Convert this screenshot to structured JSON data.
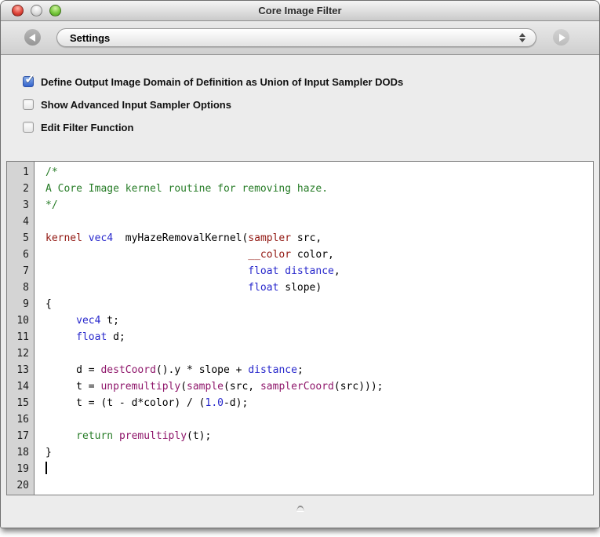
{
  "window": {
    "title": "Core Image Filter"
  },
  "titlebar_lights": {
    "close_color": "#d8453c",
    "minimize_color": "#d6d6d6",
    "zoom_color": "#6fbf3f"
  },
  "toolbar": {
    "popup_value": "Settings"
  },
  "options": [
    {
      "label": "Define Output Image Domain of Definition as Union of Input Sampler DODs",
      "checked": true
    },
    {
      "label": "Show Advanced Input Sampler Options",
      "checked": false
    },
    {
      "label": "Edit Filter Function",
      "checked": false
    }
  ],
  "colors": {
    "checkbox_checked_top": "#8ab2ef",
    "checkbox_checked_bottom": "#3463cc"
  },
  "editor": {
    "line_count": 20,
    "cursor_line": 19,
    "syntax_colors": {
      "comment": "#277c27",
      "keyword": "#921812",
      "type": "#2828cc",
      "builtin": "#8f176b",
      "plain": "#000000"
    },
    "lines": [
      [
        [
          "c",
          "/*"
        ]
      ],
      [
        [
          "c",
          "A Core Image kernel routine for removing haze."
        ]
      ],
      [
        [
          "c",
          "*/"
        ]
      ],
      [],
      [
        [
          "k",
          "kernel"
        ],
        [
          "p",
          " "
        ],
        [
          "t",
          "vec4"
        ],
        [
          "p",
          "  myHazeRemovalKernel("
        ],
        [
          "k",
          "sampler"
        ],
        [
          "p",
          " src,"
        ]
      ],
      [
        [
          "p",
          "                                 "
        ],
        [
          "k",
          "__color"
        ],
        [
          "p",
          " color,"
        ]
      ],
      [
        [
          "p",
          "                                 "
        ],
        [
          "t",
          "float"
        ],
        [
          "p",
          " "
        ],
        [
          "t",
          "distance"
        ],
        [
          "p",
          ","
        ]
      ],
      [
        [
          "p",
          "                                 "
        ],
        [
          "t",
          "float"
        ],
        [
          "p",
          " slope)"
        ]
      ],
      [
        [
          "p",
          "{"
        ]
      ],
      [
        [
          "p",
          "     "
        ],
        [
          "t",
          "vec4"
        ],
        [
          "p",
          " t;"
        ]
      ],
      [
        [
          "p",
          "     "
        ],
        [
          "t",
          "float"
        ],
        [
          "p",
          " d;"
        ]
      ],
      [],
      [
        [
          "p",
          "     d = "
        ],
        [
          "f",
          "destCoord"
        ],
        [
          "p",
          "().y * slope + "
        ],
        [
          "t",
          "distance"
        ],
        [
          "p",
          ";"
        ]
      ],
      [
        [
          "p",
          "     t = "
        ],
        [
          "f",
          "unpremultiply"
        ],
        [
          "p",
          "("
        ],
        [
          "f",
          "sample"
        ],
        [
          "p",
          "(src, "
        ],
        [
          "f",
          "samplerCoord"
        ],
        [
          "p",
          "(src)));"
        ]
      ],
      [
        [
          "p",
          "     t = (t - d*color) / ("
        ],
        [
          "t",
          "1.0"
        ],
        [
          "p",
          "-d);"
        ]
      ],
      [],
      [
        [
          "p",
          "     "
        ],
        [
          "c",
          "return"
        ],
        [
          "p",
          " "
        ],
        [
          "f",
          "premultiply"
        ],
        [
          "p",
          "(t);"
        ]
      ],
      [
        [
          "p",
          "}"
        ]
      ],
      [],
      []
    ]
  }
}
